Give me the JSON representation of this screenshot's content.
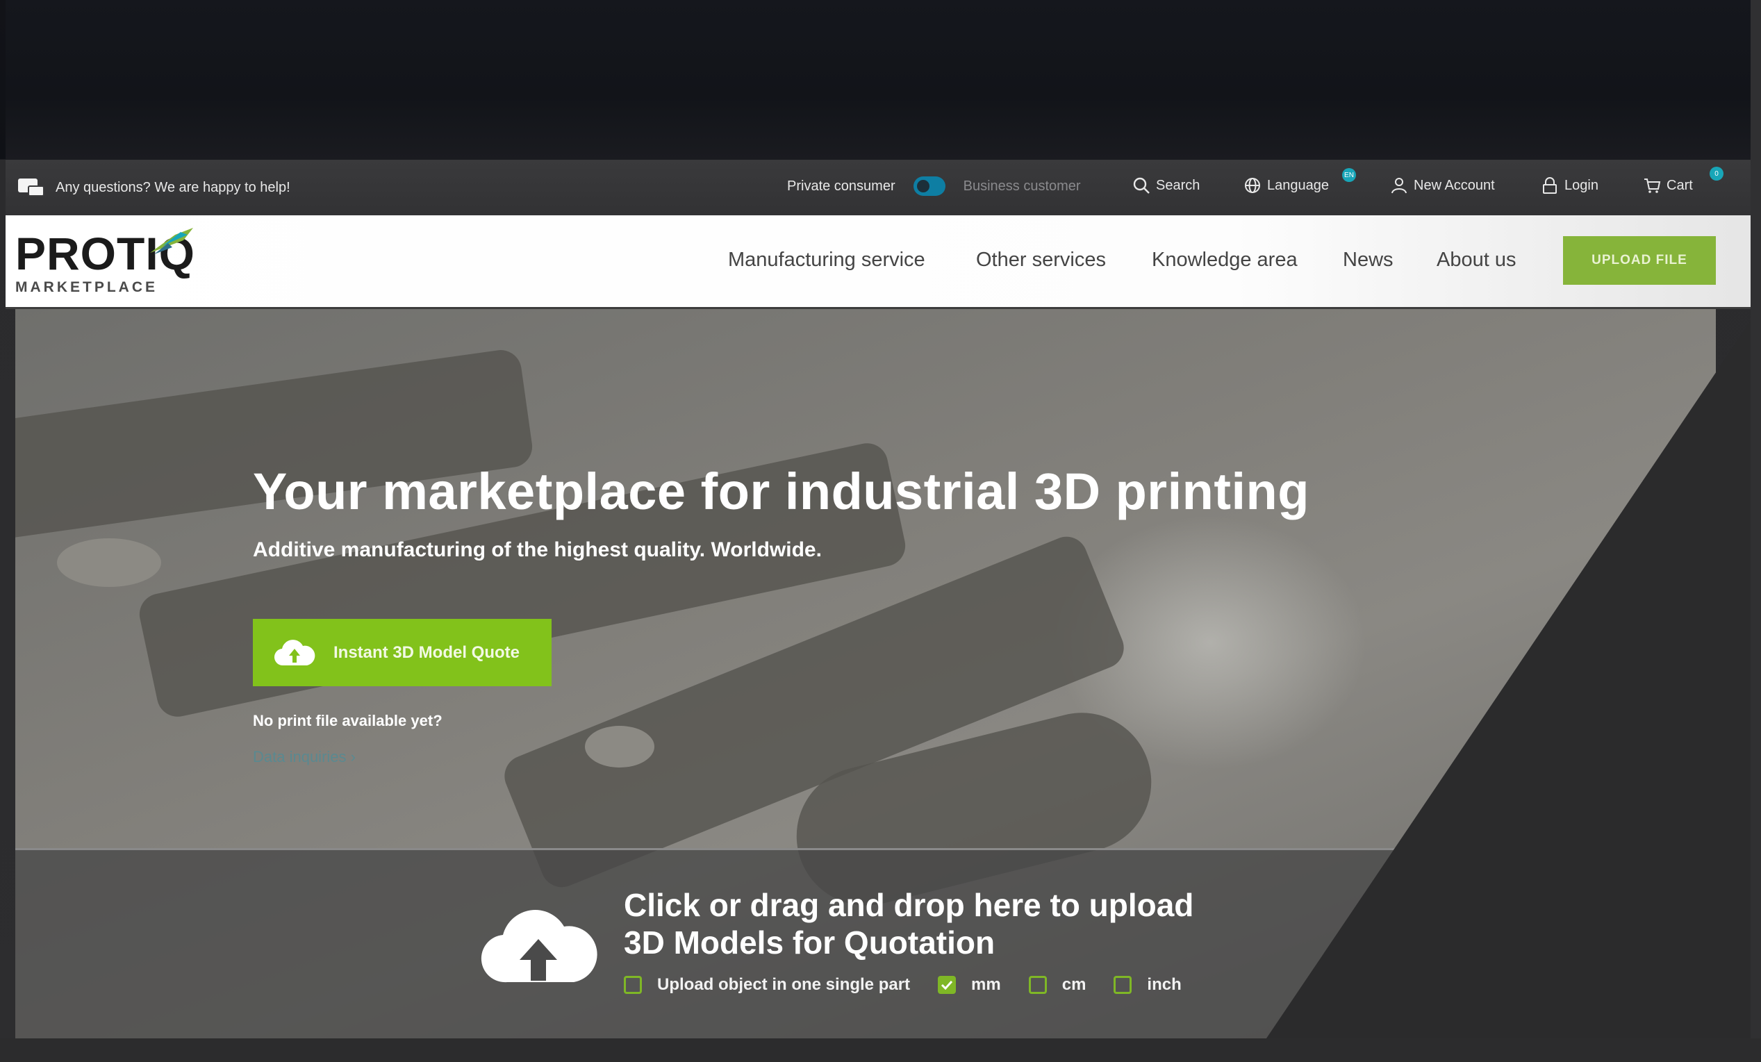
{
  "infobar": {
    "help_text": "Any questions? We are happy to help!",
    "private_label": "Private consumer",
    "business_label": "Business customer",
    "search_label": "Search",
    "language_label": "Language",
    "language_badge": "EN",
    "new_account_label": "New Account",
    "login_label": "Login",
    "cart_label": "Cart",
    "cart_count": "0"
  },
  "brand": {
    "name": "PROTIQ",
    "sub": "MARKETPLACE"
  },
  "nav": {
    "items": [
      {
        "label": "Manufacturing service"
      },
      {
        "label": "Other services"
      },
      {
        "label": "Knowledge area"
      },
      {
        "label": "News"
      },
      {
        "label": "About us"
      }
    ],
    "upload_label": "UPLOAD FILE"
  },
  "hero": {
    "title": "Your marketplace for industrial 3D printing",
    "subtitle": "Additive manufacturing of the highest quality. Worldwide.",
    "quote_button": "Instant 3D Model Quote",
    "no_print_text": "No print file available yet?",
    "data_inquiry_link": "Data inquiries ›"
  },
  "dropzone": {
    "title_line1": "Click or drag and drop here to upload",
    "title_line2": "3D Models for Quotation",
    "options": [
      {
        "label": "Upload object in one single part",
        "checked": false
      },
      {
        "label": "mm",
        "checked": true
      },
      {
        "label": "cm",
        "checked": false
      },
      {
        "label": "inch",
        "checked": false
      }
    ]
  },
  "colors": {
    "accent_green": "#82c21b",
    "toggle_blue": "#0e7ea3",
    "badge_teal": "#18a6b8"
  }
}
